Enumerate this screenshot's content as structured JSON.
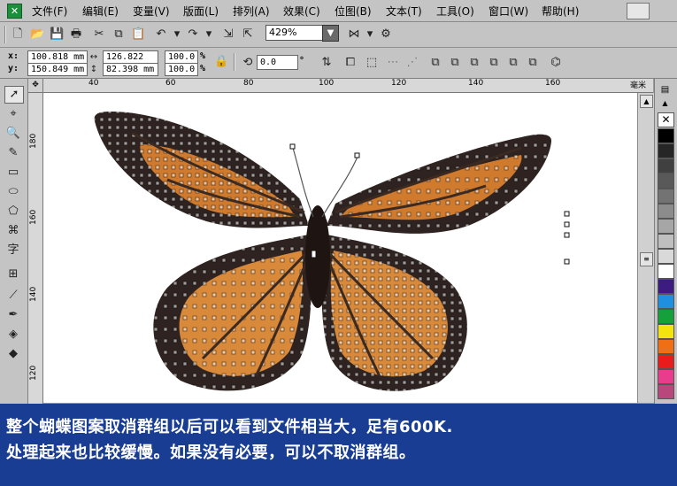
{
  "menu": {
    "items": [
      "文件(F)",
      "编辑(E)",
      "变量(V)",
      "版面(L)",
      "排列(A)",
      "效果(C)",
      "位图(B)",
      "文本(T)",
      "工具(O)",
      "窗口(W)",
      "帮助(H)"
    ]
  },
  "toolbar": {
    "zoom_value": "429%",
    "x_label": "x:",
    "y_label": "y:",
    "x_value": "100.818 mm",
    "y_value": "150.849 mm",
    "width_value": "126.822 mm",
    "height_value": "82.398 mm",
    "scale_x": "100.0",
    "scale_y": "100.0",
    "percent": "%",
    "rotation_value": "0.0",
    "degree": "°"
  },
  "ruler": {
    "unit": "毫米",
    "h_ticks": [
      "40",
      "60",
      "80",
      "100",
      "120",
      "140",
      "160"
    ],
    "v_ticks": [
      "180",
      "160",
      "140",
      "120"
    ]
  },
  "palette": {
    "colors": [
      "#000000",
      "#262626",
      "#404040",
      "#595959",
      "#737373",
      "#8c8c8c",
      "#a6a6a6",
      "#bfbfbf",
      "#d9d9d9",
      "#ffffff",
      "#3c1c80",
      "#1f8fe0",
      "#15a03c",
      "#f2e40c",
      "#f06e14",
      "#e81c1c",
      "#e83c8c",
      "#b8487c"
    ]
  },
  "caption": {
    "line1": "整个蝴蝶图案取消群组以后可以看到文件相当大，足有600K.",
    "line2": "处理起来也比较缓慢。如果没有必要，可以不取消群组。"
  }
}
